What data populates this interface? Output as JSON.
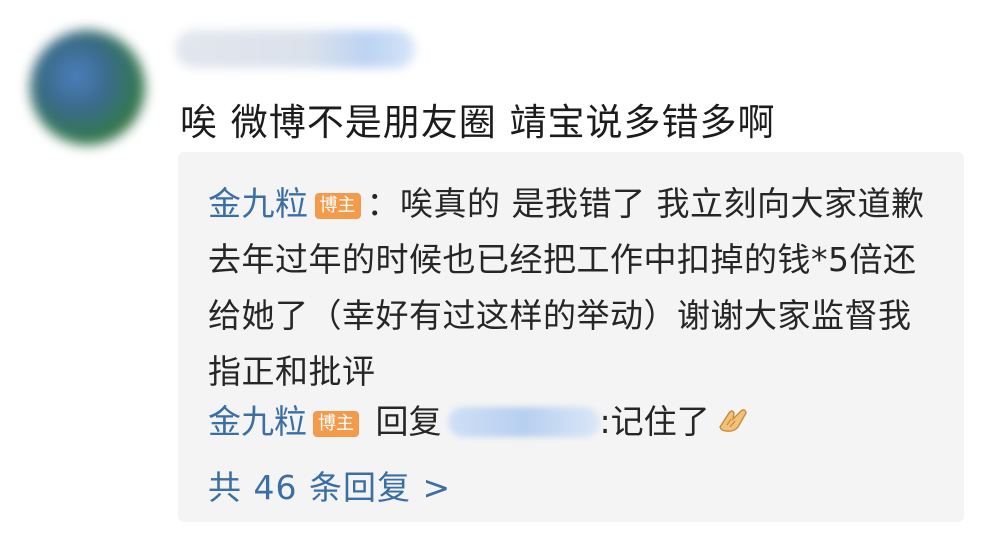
{
  "comment": {
    "text": "唉 微博不是朋友圈 靖宝说多错多啊"
  },
  "reply_thread": {
    "reply1": {
      "author": "金九粒",
      "badge": "博主",
      "text": "：唉真的 是我错了 我立刻向大家道歉 去年过年的时候也已经把工作中扣掉的钱*5倍还给她了（幸好有过这样的举动）谢谢大家监督我 指正和批评"
    },
    "reply2": {
      "author": "金九粒",
      "badge": "博主",
      "verb": "回复",
      "text": ":记住了",
      "emoji": "pray-hands-emoji"
    },
    "total_replies": "共 46 条回复 >"
  }
}
